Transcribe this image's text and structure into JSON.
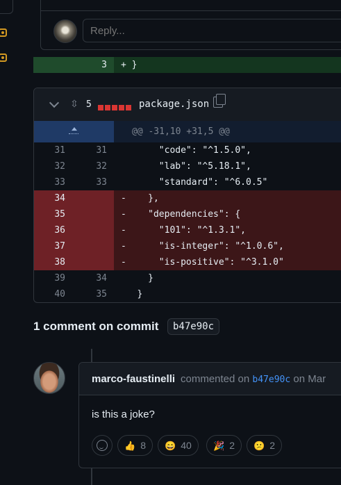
{
  "reply": {
    "placeholder": "Reply..."
  },
  "added_line": {
    "number": "3",
    "code": "+ }"
  },
  "file": {
    "change_count": "5",
    "name": "package.json",
    "hunk_header": "@@ -31,10 +31,5 @@",
    "lines": [
      {
        "old": "31",
        "new": "31",
        "sign": " ",
        "code": "    \"code\": \"^1.5.0\",",
        "type": "context"
      },
      {
        "old": "32",
        "new": "32",
        "sign": " ",
        "code": "    \"lab\": \"^5.18.1\",",
        "type": "context"
      },
      {
        "old": "33",
        "new": "33",
        "sign": " ",
        "code": "    \"standard\": \"^6.0.5\"",
        "type": "context"
      },
      {
        "old": "34",
        "new": "",
        "sign": "-",
        "code": "  },",
        "type": "del"
      },
      {
        "old": "35",
        "new": "",
        "sign": "-",
        "code": "  \"dependencies\": {",
        "type": "del"
      },
      {
        "old": "36",
        "new": "",
        "sign": "-",
        "code": "    \"101\": \"^1.3.1\",",
        "type": "del"
      },
      {
        "old": "37",
        "new": "",
        "sign": "-",
        "code": "    \"is-integer\": \"^1.0.6\",",
        "type": "del"
      },
      {
        "old": "38",
        "new": "",
        "sign": "-",
        "code": "    \"is-positive\": \"^3.1.0\"",
        "type": "del"
      },
      {
        "old": "39",
        "new": "34",
        "sign": " ",
        "code": "  }",
        "type": "context"
      },
      {
        "old": "40",
        "new": "35",
        "sign": " ",
        "code": "}",
        "type": "context"
      }
    ]
  },
  "comments": {
    "title": "1 comment on commit",
    "sha": "b47e90c"
  },
  "comment": {
    "author": "marco-faustinelli",
    "action": "commented on",
    "sha": "b47e90c",
    "date_prefix": "on Mar",
    "body": "is this a joke?",
    "reactions": [
      {
        "emoji": "👍",
        "count": "8"
      },
      {
        "emoji": "😄",
        "count": "40"
      },
      {
        "emoji": "🎉",
        "count": "2"
      },
      {
        "emoji": "😕",
        "count": "2"
      }
    ]
  },
  "colors": {
    "deleted": "#da3633",
    "link": "#4493f8",
    "added_bg": "#1f4b2c"
  }
}
